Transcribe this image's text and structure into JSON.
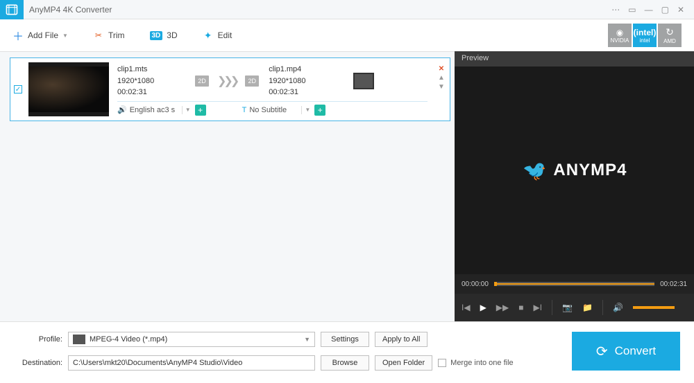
{
  "app": {
    "title": "AnyMP4 4K Converter"
  },
  "toolbar": {
    "add_file": "Add File",
    "trim": "Trim",
    "three_d": "3D",
    "edit": "Edit"
  },
  "gpu": {
    "nvidia": "NVIDIA",
    "intel": "intel",
    "amd": "AMD"
  },
  "file": {
    "src_name": "clip1.mts",
    "src_res": "1920*1080",
    "src_dur": "00:02:31",
    "src_fmt": "2D",
    "dst_name": "clip1.mp4",
    "dst_res": "1920*1080",
    "dst_dur": "00:02:31",
    "dst_fmt": "2D",
    "audio": "English ac3 s",
    "subtitle": "No Subtitle"
  },
  "preview": {
    "title": "Preview",
    "brand": "ANYMP4",
    "t_cur": "00:00:00",
    "t_total": "00:02:31"
  },
  "profile": {
    "label": "Profile:",
    "value": "MPEG-4 Video (*.mp4)",
    "settings": "Settings",
    "apply_all": "Apply to All"
  },
  "destination": {
    "label": "Destination:",
    "value": "C:\\Users\\mkt20\\Documents\\AnyMP4 Studio\\Video",
    "browse": "Browse",
    "open_folder": "Open Folder",
    "merge": "Merge into one file"
  },
  "convert": "Convert"
}
